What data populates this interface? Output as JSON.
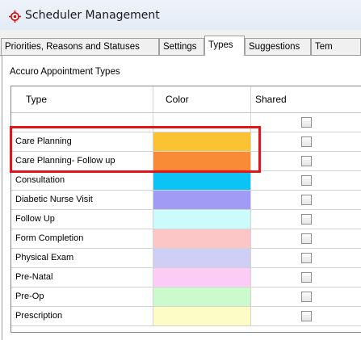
{
  "window": {
    "title": "Scheduler Management",
    "icon": "scheduler-crosshair-icon",
    "icon_color": "#cc1010"
  },
  "tabs": [
    {
      "label": "Priorities, Reasons and Statuses",
      "active": false
    },
    {
      "label": "Settings",
      "active": false
    },
    {
      "label": "Types",
      "active": true
    },
    {
      "label": "Suggestions",
      "active": false
    },
    {
      "label": "Tem",
      "active": false
    }
  ],
  "section_title": "Accuro Appointment Types",
  "grid": {
    "columns": [
      "Type",
      "Color",
      "Shared"
    ],
    "rows": [
      {
        "type": "",
        "color": "#ffffff",
        "shared": false
      },
      {
        "type": "Care Planning",
        "color": "#fbc331",
        "shared": false
      },
      {
        "type": "Care Planning- Follow up",
        "color": "#f98a36",
        "shared": false
      },
      {
        "type": "Consultation",
        "color": "#0bc3f4",
        "shared": false
      },
      {
        "type": "Diabetic Nurse Visit",
        "color": "#a09cf6",
        "shared": false
      },
      {
        "type": "Follow Up",
        "color": "#ccfbfb",
        "shared": false
      },
      {
        "type": "Form Completion",
        "color": "#fcc6c6",
        "shared": false
      },
      {
        "type": "Physical Exam",
        "color": "#cecef6",
        "shared": false
      },
      {
        "type": "Pre-Natal",
        "color": "#fccbf6",
        "shared": false
      },
      {
        "type": "Pre-Op",
        "color": "#ccfacc",
        "shared": false
      },
      {
        "type": "Prescription",
        "color": "#fefcc6",
        "shared": false
      }
    ]
  },
  "annotation_color": "#e3151a"
}
